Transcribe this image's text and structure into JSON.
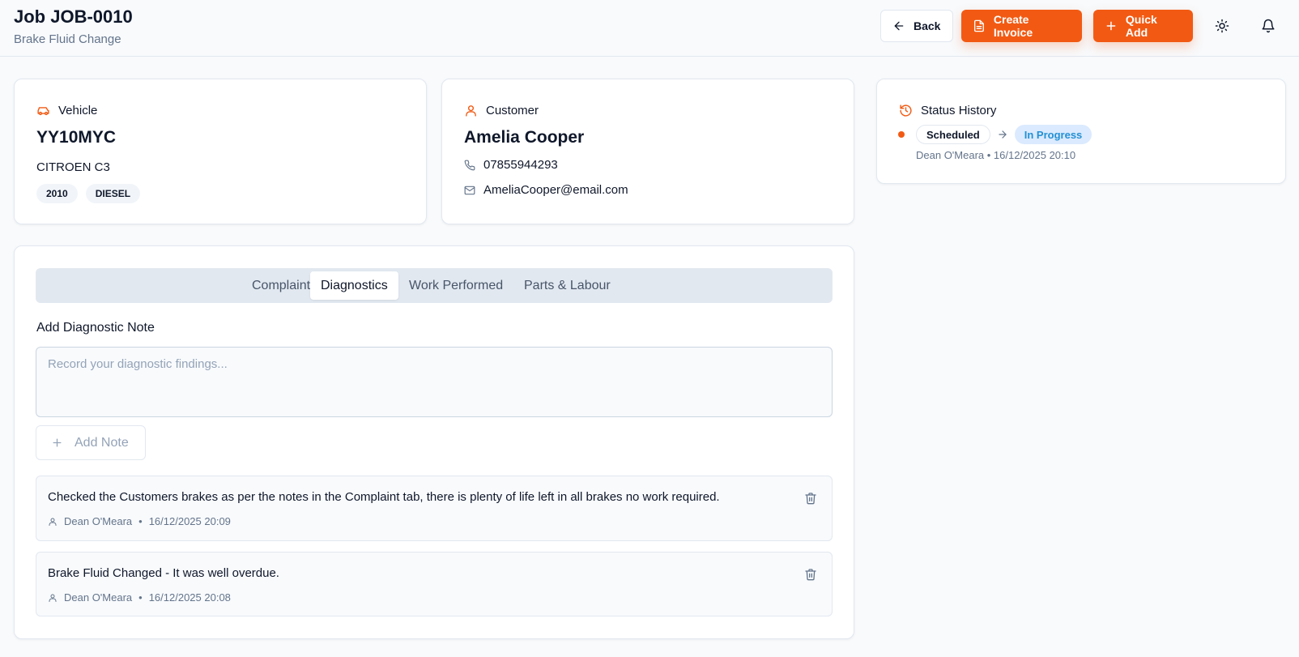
{
  "header": {
    "title": "Job JOB-0010",
    "subtitle": "Brake Fluid Change",
    "back_label": "Back",
    "create_invoice_label": "Create Invoice",
    "quick_add_label": "Quick Add"
  },
  "vehicle": {
    "heading": "Vehicle",
    "registration": "YY10MYC",
    "make_model": "CITROEN C3",
    "tags": [
      "2010",
      "DIESEL"
    ]
  },
  "customer": {
    "heading": "Customer",
    "name": "Amelia Cooper",
    "phone": "07855944293",
    "email": "AmeliaCooper@email.com"
  },
  "status_history": {
    "heading": "Status History",
    "from_status": "Scheduled",
    "to_status": "In Progress",
    "meta": "Dean O'Meara • 16/12/2025 20:10"
  },
  "tabs": [
    "Complaint",
    "Diagnostics",
    "Work Performed",
    "Parts & Labour"
  ],
  "diagnostics": {
    "section_label": "Add Diagnostic Note",
    "placeholder": "Record your diagnostic findings...",
    "add_note_label": "Add Note",
    "notes": [
      {
        "text": "Checked the Customers brakes as per the notes in the Complaint tab, there is plenty of life left in all brakes no work required.",
        "author": "Dean O'Meara",
        "timestamp": "16/12/2025 20:09"
      },
      {
        "text": "Brake Fluid Changed - It was well overdue.",
        "author": "Dean O'Meara",
        "timestamp": "16/12/2025 20:08"
      }
    ]
  },
  "colors": {
    "accent": "#f25a13",
    "in_progress": "#2490d4"
  }
}
